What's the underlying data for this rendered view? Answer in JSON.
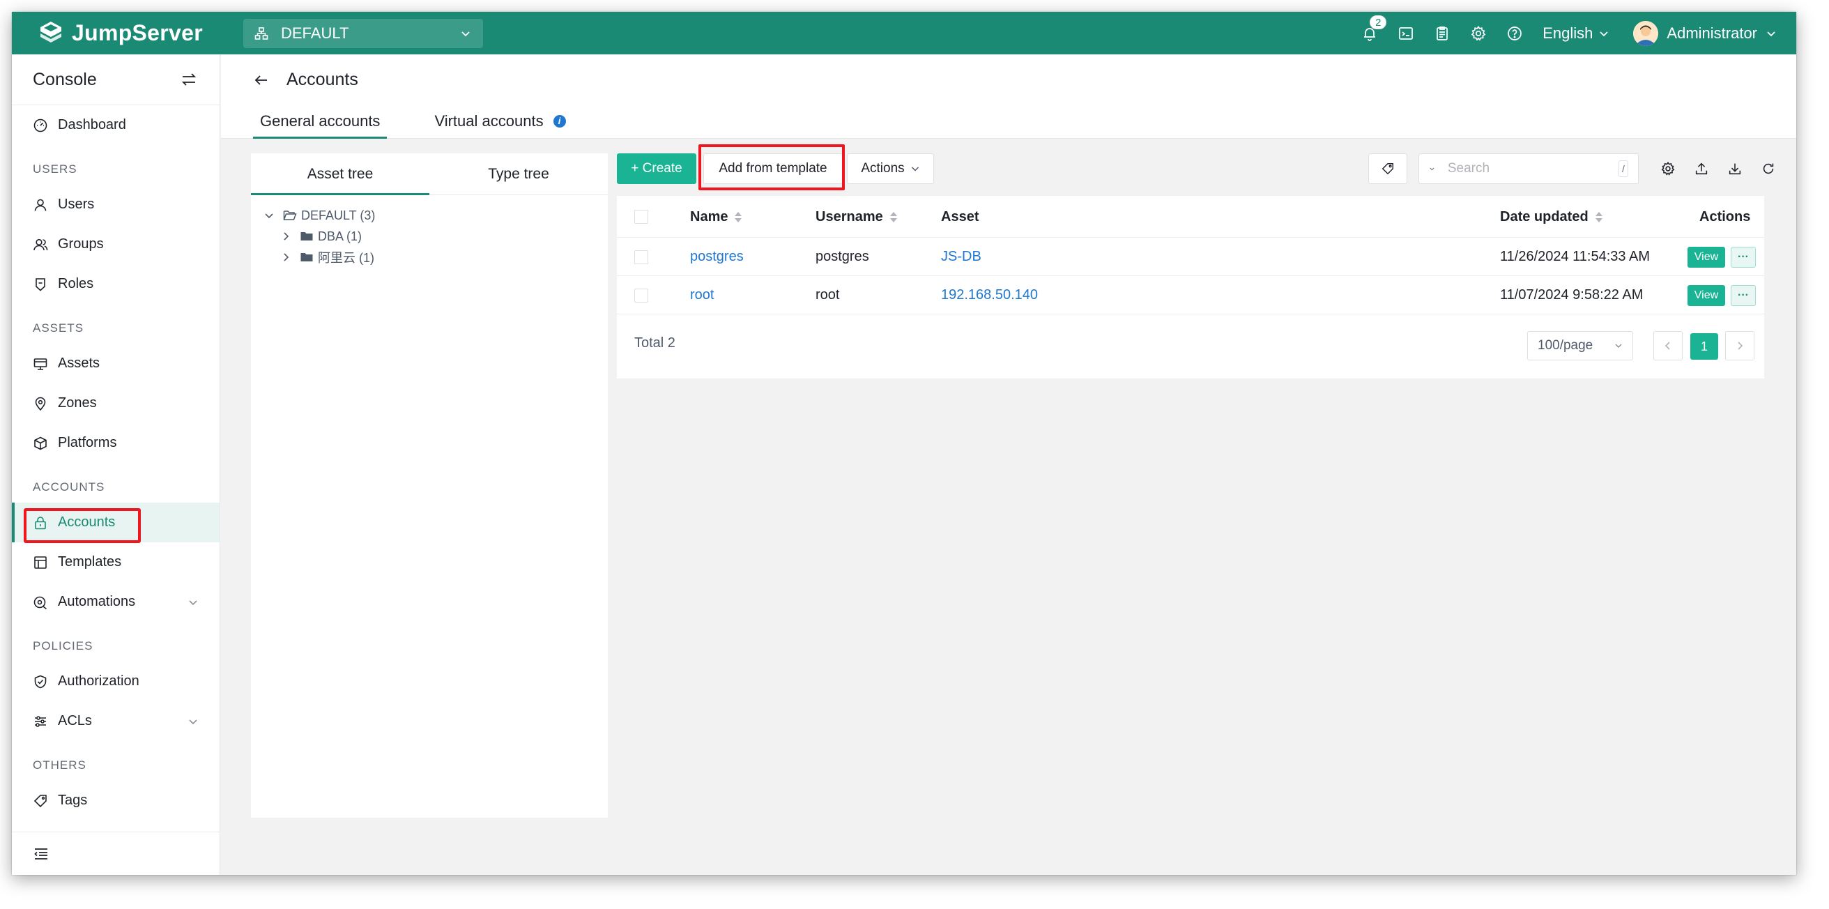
{
  "topbar": {
    "logo_text": "JumpServer",
    "org": "DEFAULT",
    "notification_count": "2",
    "language": "English",
    "user_name": "Administrator",
    "brand_color": "#1a8a75"
  },
  "sidebar": {
    "title": "Console",
    "groups": {
      "users": "USERS",
      "assets": "ASSETS",
      "accounts": "ACCOUNTS",
      "policies": "POLICIES",
      "others": "OTHERS"
    },
    "items": {
      "dashboard": "Dashboard",
      "users": "Users",
      "groups": "Groups",
      "roles": "Roles",
      "assets": "Assets",
      "zones": "Zones",
      "platforms": "Platforms",
      "accounts": "Accounts",
      "templates": "Templates",
      "automations": "Automations",
      "authorization": "Authorization",
      "acls": "ACLs",
      "tags": "Tags"
    },
    "active_item": "Accounts"
  },
  "page": {
    "title": "Accounts",
    "tabs": [
      "General accounts",
      "Virtual accounts"
    ],
    "active_tab": "General accounts"
  },
  "tree": {
    "tabs": [
      "Asset tree",
      "Type tree"
    ],
    "active_tab": "Asset tree",
    "root": "DEFAULT (3)",
    "children": [
      "DBA (1)",
      "阿里云 (1)"
    ]
  },
  "toolbar": {
    "create_label": "+ Create",
    "template_label": "Add from template",
    "actions_label": "Actions",
    "search_placeholder": "Search",
    "search_shortcut": "/"
  },
  "table": {
    "columns": {
      "name": "Name",
      "username": "Username",
      "asset": "Asset",
      "date_updated": "Date updated",
      "actions": "Actions"
    },
    "rows": [
      {
        "name": "postgres",
        "username": "postgres",
        "asset": "JS-DB",
        "date_updated": "11/26/2024 11:54:33 AM",
        "view": "View",
        "more": "···"
      },
      {
        "name": "root",
        "username": "root",
        "asset": "192.168.50.140",
        "date_updated": "11/07/2024 9:58:22 AM",
        "view": "View",
        "more": "···"
      }
    ],
    "total": "Total 2",
    "page_size": "100/page",
    "current_page": "1"
  }
}
